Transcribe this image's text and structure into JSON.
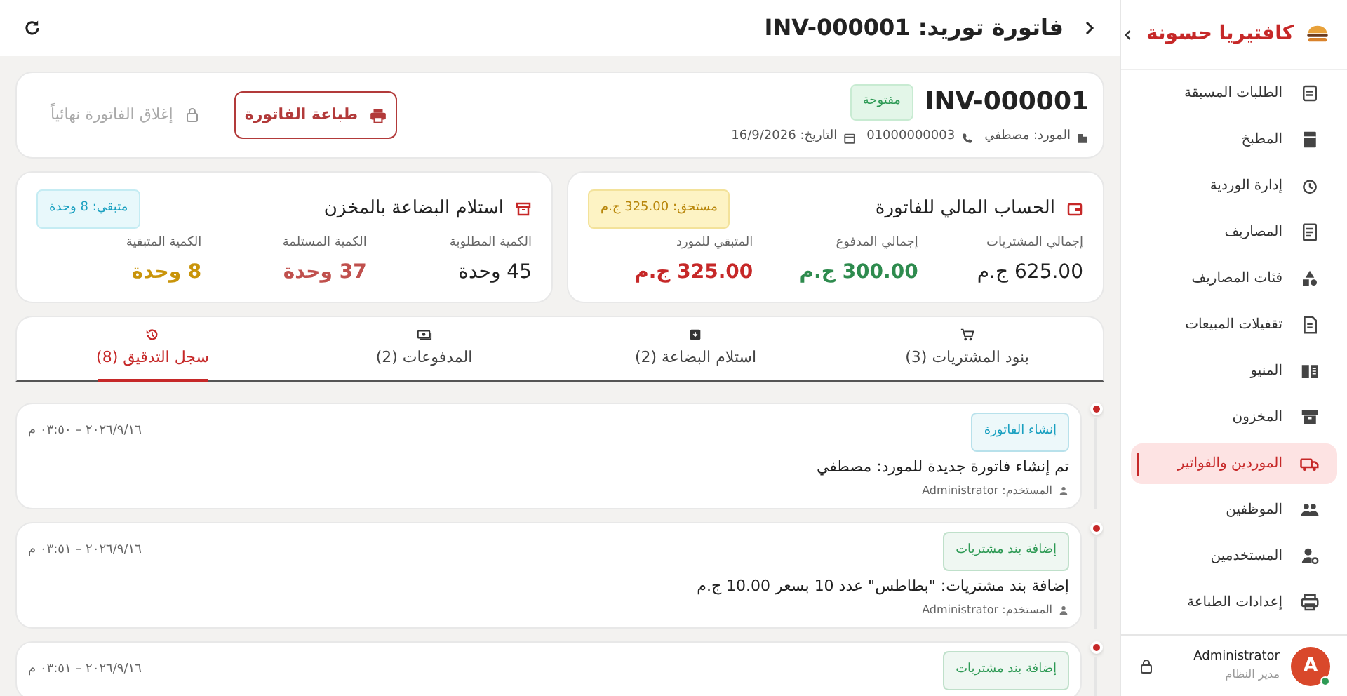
{
  "header": {
    "title": "فاتورة توريد: INV-000001"
  },
  "invoice": {
    "number": "INV-000001",
    "status": "مفتوحة",
    "supplier": "المورد: مصطفي",
    "phone": "01000000003",
    "date": "التاريخ: 16/9/2026",
    "print_button": "طباعة الفاتورة",
    "close_button": {
      "label": "إغلاق الفاتورة نهائياً",
      "disabled": true
    }
  },
  "financial": {
    "title": "الحساب المالي للفاتورة",
    "badge": "مستحق: 325.00 ج.م",
    "stats": [
      {
        "label": "إجمالي المشتريات",
        "value": "625.00 ج.م",
        "color": "#222222"
      },
      {
        "label": "إجمالي المدفوع",
        "value": "300.00 ج.م",
        "color": "#2e8b4e"
      },
      {
        "label": "المتبقي للمورد",
        "value": "325.00 ج.م",
        "color": "#c62828"
      }
    ]
  },
  "receiving": {
    "title": "استلام البضاعة بالمخزن",
    "badge": "متبقي: 8 وحدة",
    "stats": [
      {
        "label": "الكمية المطلوبة",
        "value": "45 وحدة",
        "color": "#222222"
      },
      {
        "label": "الكمية المستلمة",
        "value": "37 وحدة",
        "color": "#c0504d"
      },
      {
        "label": "الكمية المتبقية",
        "value": "8 وحدة",
        "color": "#c9940a"
      }
    ]
  },
  "tabs": [
    {
      "label": "بنود المشتريات (3)",
      "selected": false
    },
    {
      "label": "استلام البضاعة (2)",
      "selected": false
    },
    {
      "label": "المدفوعات (2)",
      "selected": false
    },
    {
      "label": "سجل التدقيق (8)",
      "selected": true
    }
  ],
  "audit": [
    {
      "tag": "إنشاء الفاتورة",
      "color": "#1aa0c0",
      "time": "٢٠٢٦/٩/١٦ – ٠٣:٥٠ م",
      "message": "تم إنشاء فاتورة جديدة للمورد: مصطفي",
      "user": "المستخدم: Administrator"
    },
    {
      "tag": "إضافة بند مشتريات",
      "color": "#2e9a55",
      "time": "٢٠٢٦/٩/١٦ – ٠٣:٥١ م",
      "message": "إضافة بند مشتريات: \"بطاطس\" عدد 10 بسعر 10.00 ج.م",
      "user": "المستخدم: Administrator"
    },
    {
      "tag": "إضافة بند مشتريات",
      "color": "#2e9a55",
      "time": "٢٠٢٦/٩/١٦ – ٠٣:٥١ م"
    }
  ],
  "sidebar": {
    "brand": "كافتيريا حسونة",
    "items": [
      {
        "label": "الطلبات المسبقة",
        "selected": false
      },
      {
        "label": "المطبخ",
        "selected": false
      },
      {
        "label": "إدارة الوردية",
        "selected": false
      },
      {
        "label": "المصاريف",
        "selected": false
      },
      {
        "label": "فئات المصاريف",
        "selected": false
      },
      {
        "label": "تقفيلات المبيعات",
        "selected": false
      },
      {
        "label": "المنيو",
        "selected": false
      },
      {
        "label": "المخزون",
        "selected": false
      },
      {
        "label": "الموردين والفواتير",
        "selected": true
      },
      {
        "label": "الموظفين",
        "selected": false
      },
      {
        "label": "المستخدمين",
        "selected": false
      },
      {
        "label": "إعدادات الطباعة",
        "selected": false
      }
    ],
    "user": {
      "name": "Administrator",
      "role": "مدير النظام",
      "initial": "A",
      "online": true
    }
  }
}
